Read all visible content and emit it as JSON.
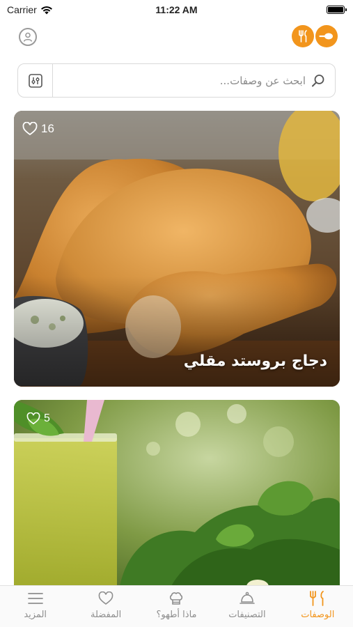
{
  "status_bar": {
    "carrier": "Carrier",
    "time": "11:22 AM"
  },
  "header": {
    "avatar_icon": "user-circle-icon",
    "logo_icon": "fork-knife-logo",
    "brand_color": "#F2951C"
  },
  "search": {
    "placeholder": "ابحث عن وصفات...",
    "value": "",
    "filter_icon": "sliders-icon",
    "search_icon": "search-icon"
  },
  "recipes": [
    {
      "title": "دجاج بروستد مقلي",
      "likes": "16",
      "image": "fried-chicken-photo"
    },
    {
      "title": "",
      "likes": "5",
      "image": "green-smoothie-photo"
    }
  ],
  "tab_bar": {
    "active_color": "#F2951C",
    "items": [
      {
        "label": "الوصفات",
        "icon": "fork-knife-icon",
        "active": true
      },
      {
        "label": "التصنيفات",
        "icon": "cloche-icon",
        "active": false
      },
      {
        "label": "ماذا أطهو؟",
        "icon": "chef-hat-icon",
        "active": false
      },
      {
        "label": "المفضلة",
        "icon": "heart-icon",
        "active": false
      },
      {
        "label": "المزيد",
        "icon": "menu-icon",
        "active": false
      }
    ]
  }
}
